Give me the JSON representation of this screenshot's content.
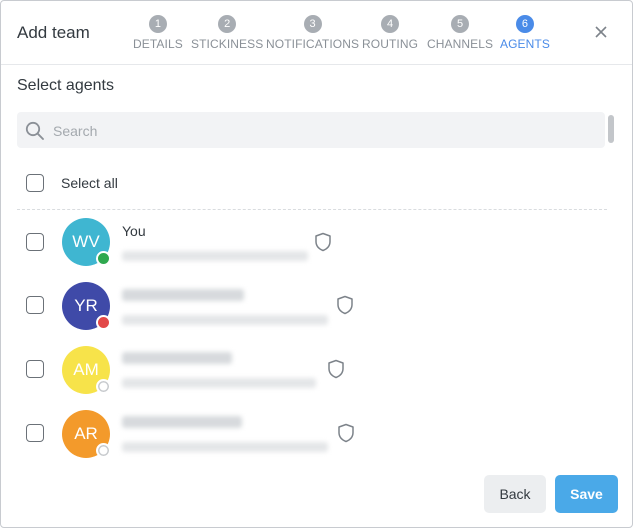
{
  "modal": {
    "title": "Add team",
    "close_icon": "close-icon"
  },
  "steps": [
    {
      "number": "1",
      "label": "DETAILS",
      "active": false
    },
    {
      "number": "2",
      "label": "STICKINESS",
      "active": false
    },
    {
      "number": "3",
      "label": "NOTIFICATIONS",
      "active": false
    },
    {
      "number": "4",
      "label": "ROUTING",
      "active": false
    },
    {
      "number": "5",
      "label": "CHANNELS",
      "active": false
    },
    {
      "number": "6",
      "label": "AGENTS",
      "active": true
    }
  ],
  "section": {
    "title": "Select agents"
  },
  "search": {
    "placeholder": "Search",
    "value": "",
    "icon": "search-icon"
  },
  "select_all": {
    "label": "Select all",
    "checked": false
  },
  "agents": [
    {
      "initials": "WV",
      "name": "You",
      "avatar_color": "#3fb6d1",
      "status_color": "#2fa84f",
      "name_visible": true
    },
    {
      "initials": "YR",
      "name": "",
      "avatar_color": "#3f4aa8",
      "status_color": "#e24848",
      "name_visible": false
    },
    {
      "initials": "AM",
      "name": "",
      "avatar_color": "#f7e34a",
      "status_color": "#ffffff",
      "name_visible": false
    },
    {
      "initials": "AR",
      "name": "",
      "avatar_color": "#f39a2b",
      "status_color": "#ffffff",
      "name_visible": false
    }
  ],
  "footer": {
    "back_label": "Back",
    "save_label": "Save"
  },
  "colors": {
    "accent": "#4a8be8",
    "save_button": "#4aa9e8"
  }
}
